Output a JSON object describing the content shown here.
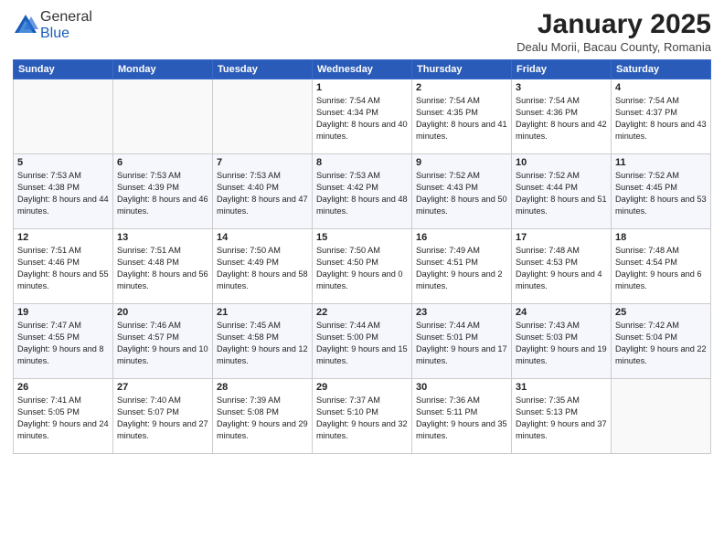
{
  "header": {
    "logo_general": "General",
    "logo_blue": "Blue",
    "month_title": "January 2025",
    "subtitle": "Dealu Morii, Bacau County, Romania"
  },
  "weekdays": [
    "Sunday",
    "Monday",
    "Tuesday",
    "Wednesday",
    "Thursday",
    "Friday",
    "Saturday"
  ],
  "weeks": [
    [
      {
        "day": "",
        "data": ""
      },
      {
        "day": "",
        "data": ""
      },
      {
        "day": "",
        "data": ""
      },
      {
        "day": "1",
        "data": "Sunrise: 7:54 AM\nSunset: 4:34 PM\nDaylight: 8 hours and 40 minutes."
      },
      {
        "day": "2",
        "data": "Sunrise: 7:54 AM\nSunset: 4:35 PM\nDaylight: 8 hours and 41 minutes."
      },
      {
        "day": "3",
        "data": "Sunrise: 7:54 AM\nSunset: 4:36 PM\nDaylight: 8 hours and 42 minutes."
      },
      {
        "day": "4",
        "data": "Sunrise: 7:54 AM\nSunset: 4:37 PM\nDaylight: 8 hours and 43 minutes."
      }
    ],
    [
      {
        "day": "5",
        "data": "Sunrise: 7:53 AM\nSunset: 4:38 PM\nDaylight: 8 hours and 44 minutes."
      },
      {
        "day": "6",
        "data": "Sunrise: 7:53 AM\nSunset: 4:39 PM\nDaylight: 8 hours and 46 minutes."
      },
      {
        "day": "7",
        "data": "Sunrise: 7:53 AM\nSunset: 4:40 PM\nDaylight: 8 hours and 47 minutes."
      },
      {
        "day": "8",
        "data": "Sunrise: 7:53 AM\nSunset: 4:42 PM\nDaylight: 8 hours and 48 minutes."
      },
      {
        "day": "9",
        "data": "Sunrise: 7:52 AM\nSunset: 4:43 PM\nDaylight: 8 hours and 50 minutes."
      },
      {
        "day": "10",
        "data": "Sunrise: 7:52 AM\nSunset: 4:44 PM\nDaylight: 8 hours and 51 minutes."
      },
      {
        "day": "11",
        "data": "Sunrise: 7:52 AM\nSunset: 4:45 PM\nDaylight: 8 hours and 53 minutes."
      }
    ],
    [
      {
        "day": "12",
        "data": "Sunrise: 7:51 AM\nSunset: 4:46 PM\nDaylight: 8 hours and 55 minutes."
      },
      {
        "day": "13",
        "data": "Sunrise: 7:51 AM\nSunset: 4:48 PM\nDaylight: 8 hours and 56 minutes."
      },
      {
        "day": "14",
        "data": "Sunrise: 7:50 AM\nSunset: 4:49 PM\nDaylight: 8 hours and 58 minutes."
      },
      {
        "day": "15",
        "data": "Sunrise: 7:50 AM\nSunset: 4:50 PM\nDaylight: 9 hours and 0 minutes."
      },
      {
        "day": "16",
        "data": "Sunrise: 7:49 AM\nSunset: 4:51 PM\nDaylight: 9 hours and 2 minutes."
      },
      {
        "day": "17",
        "data": "Sunrise: 7:48 AM\nSunset: 4:53 PM\nDaylight: 9 hours and 4 minutes."
      },
      {
        "day": "18",
        "data": "Sunrise: 7:48 AM\nSunset: 4:54 PM\nDaylight: 9 hours and 6 minutes."
      }
    ],
    [
      {
        "day": "19",
        "data": "Sunrise: 7:47 AM\nSunset: 4:55 PM\nDaylight: 9 hours and 8 minutes."
      },
      {
        "day": "20",
        "data": "Sunrise: 7:46 AM\nSunset: 4:57 PM\nDaylight: 9 hours and 10 minutes."
      },
      {
        "day": "21",
        "data": "Sunrise: 7:45 AM\nSunset: 4:58 PM\nDaylight: 9 hours and 12 minutes."
      },
      {
        "day": "22",
        "data": "Sunrise: 7:44 AM\nSunset: 5:00 PM\nDaylight: 9 hours and 15 minutes."
      },
      {
        "day": "23",
        "data": "Sunrise: 7:44 AM\nSunset: 5:01 PM\nDaylight: 9 hours and 17 minutes."
      },
      {
        "day": "24",
        "data": "Sunrise: 7:43 AM\nSunset: 5:03 PM\nDaylight: 9 hours and 19 minutes."
      },
      {
        "day": "25",
        "data": "Sunrise: 7:42 AM\nSunset: 5:04 PM\nDaylight: 9 hours and 22 minutes."
      }
    ],
    [
      {
        "day": "26",
        "data": "Sunrise: 7:41 AM\nSunset: 5:05 PM\nDaylight: 9 hours and 24 minutes."
      },
      {
        "day": "27",
        "data": "Sunrise: 7:40 AM\nSunset: 5:07 PM\nDaylight: 9 hours and 27 minutes."
      },
      {
        "day": "28",
        "data": "Sunrise: 7:39 AM\nSunset: 5:08 PM\nDaylight: 9 hours and 29 minutes."
      },
      {
        "day": "29",
        "data": "Sunrise: 7:37 AM\nSunset: 5:10 PM\nDaylight: 9 hours and 32 minutes."
      },
      {
        "day": "30",
        "data": "Sunrise: 7:36 AM\nSunset: 5:11 PM\nDaylight: 9 hours and 35 minutes."
      },
      {
        "day": "31",
        "data": "Sunrise: 7:35 AM\nSunset: 5:13 PM\nDaylight: 9 hours and 37 minutes."
      },
      {
        "day": "",
        "data": ""
      }
    ]
  ]
}
